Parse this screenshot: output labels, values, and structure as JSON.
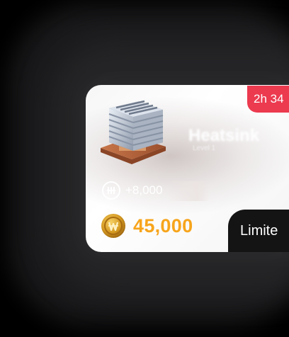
{
  "offer_card": {
    "timer": "2h 34",
    "item_name": "Heatsink",
    "item_subtitle": "Level 1",
    "bonus": "+8,000",
    "price": "45,000",
    "limited_label": "Limite"
  },
  "colors": {
    "timer_badge": "#ec3a4f",
    "price_text": "#f7a51c",
    "limited_badge": "#141414",
    "card_background": "#f6f6f7"
  },
  "icons": {
    "bonus": "hashrate-circle-icon",
    "currency": "gold-coin-icon",
    "item": "heatsink-icon"
  }
}
